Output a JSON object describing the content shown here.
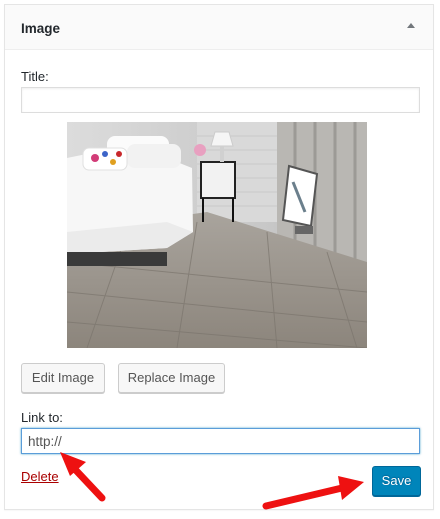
{
  "widget": {
    "title": "Image",
    "toggle_icon": "caret-up-icon"
  },
  "form": {
    "title_label": "Title:",
    "title_value": "",
    "link_label": "Link to:",
    "link_value": "http://"
  },
  "buttons": {
    "edit_image": "Edit Image",
    "replace_image": "Replace Image",
    "save": "Save",
    "delete": "Delete"
  },
  "colors": {
    "primary": "#0085ba",
    "delete": "#aa0000",
    "focus": "#5b9dd9",
    "annotation_arrow": "#ee1111"
  }
}
